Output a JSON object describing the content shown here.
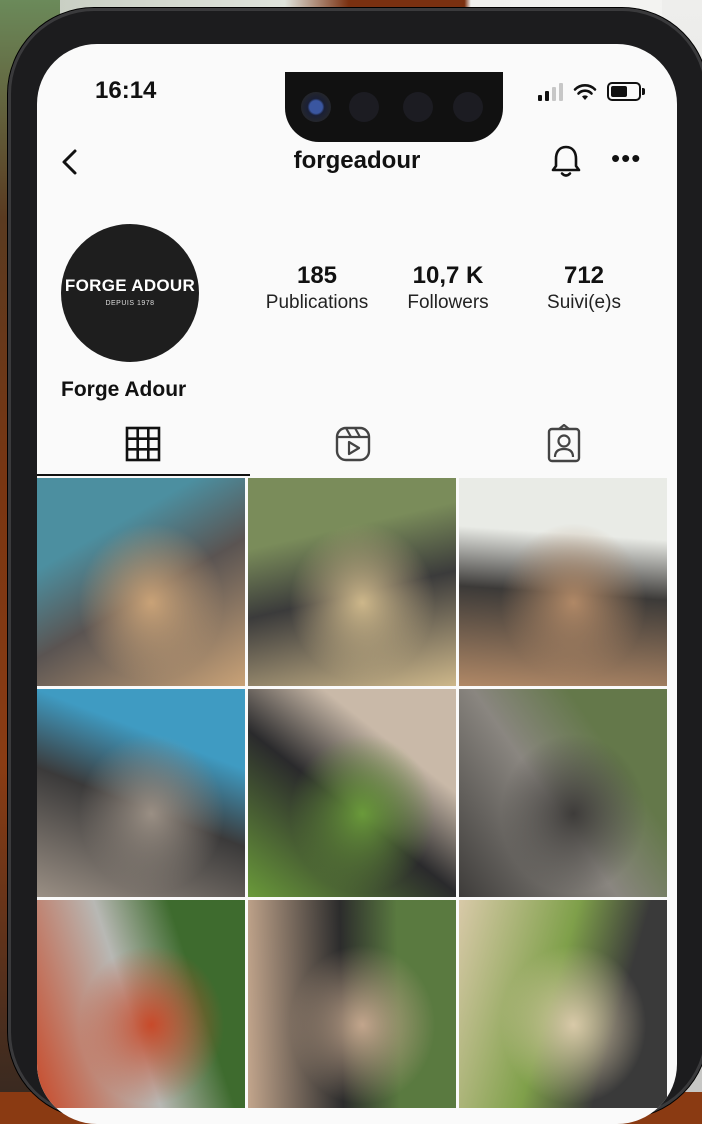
{
  "status_bar": {
    "time": "16:14",
    "battery_level": 0.6
  },
  "header": {
    "username": "forgeadour"
  },
  "profile": {
    "avatar": {
      "brand": "FORGE ADOUR",
      "since": "DEPUIS 1978"
    },
    "display_name": "Forge Adour",
    "stats": [
      {
        "value": "185",
        "label": "Publications"
      },
      {
        "value": "10,7 K",
        "label": "Followers"
      },
      {
        "value": "712",
        "label": "Suivi(e)s"
      }
    ]
  },
  "tabs": [
    {
      "icon": "grid-icon",
      "active": true
    },
    {
      "icon": "reels-icon",
      "active": false
    },
    {
      "icon": "tagged-icon",
      "active": false
    }
  ],
  "posts": [
    {
      "desc": "compact outdoor kitchen module by pool",
      "colors": [
        "#4c8fa0",
        "#5a5452",
        "#c9a277"
      ]
    },
    {
      "desc": "condiment caddy with oil and pepper mill",
      "colors": [
        "#7a8c5a",
        "#3b3b3b",
        "#cdb78a"
      ]
    },
    {
      "desc": "plancha with grilled food",
      "colors": [
        "#e9ebe6",
        "#3c3a38",
        "#b08866"
      ]
    },
    {
      "desc": "outdoor kitchen island by pool",
      "colors": [
        "#3f9bc2",
        "#3b3a3a",
        "#9a8f84"
      ]
    },
    {
      "desc": "peppers on plancha with spatula",
      "colors": [
        "#c9b9a8",
        "#2a2a2c",
        "#6a9a3a"
      ]
    },
    {
      "desc": "outdoor kitchen bar with stools",
      "colors": [
        "#64784a",
        "#8a8680",
        "#3e3c3a"
      ]
    },
    {
      "desc": "rinsing fruit in kitchen sink",
      "colors": [
        "#3e6b2e",
        "#b8b8b4",
        "#c84a2a"
      ]
    },
    {
      "desc": "cook wearing Forge Adour apron",
      "colors": [
        "#5a7a40",
        "#2c2c2c",
        "#c2a58c"
      ]
    },
    {
      "desc": "grilled peppers and olive oil",
      "colors": [
        "#3a3a3a",
        "#7fa04a",
        "#d8c9a8"
      ]
    }
  ]
}
